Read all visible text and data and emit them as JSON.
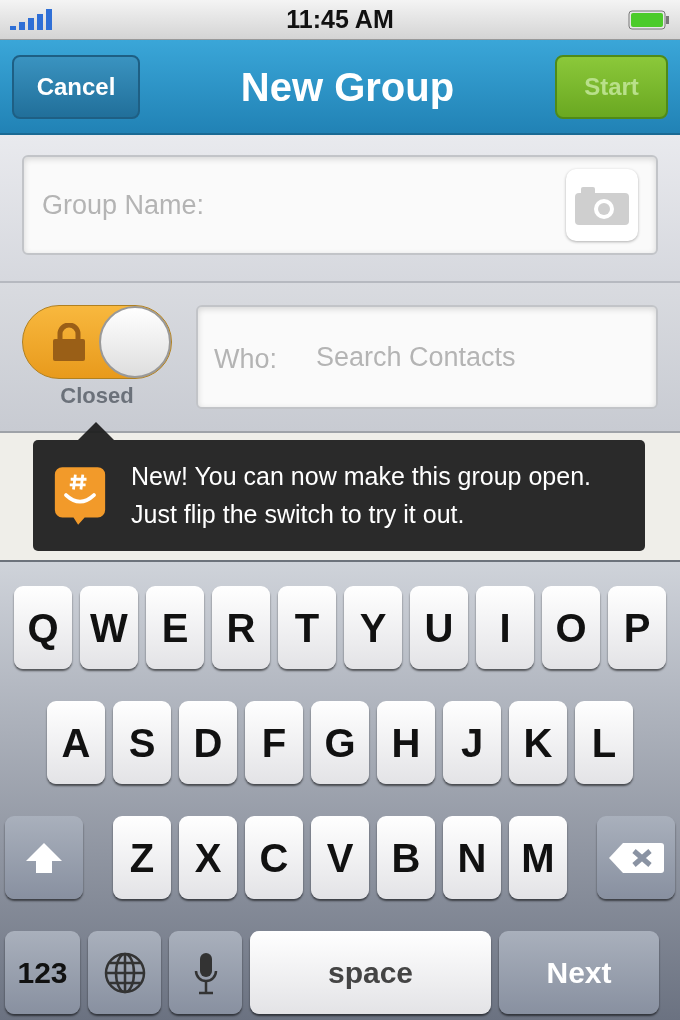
{
  "status_bar": {
    "time": "11:45 AM"
  },
  "nav": {
    "cancel": "Cancel",
    "title": "New Group",
    "start": {
      "label": "Start",
      "disabled": true
    }
  },
  "group_name": {
    "placeholder": "Group Name:"
  },
  "privacy_switch": {
    "open": false,
    "label": "Closed"
  },
  "who": {
    "label": "Who:",
    "placeholder": "Search Contacts"
  },
  "tooltip": {
    "text": "New! You can now make this group open. Just flip the switch to try it out."
  },
  "keyboard": {
    "rows": [
      {
        "keys": [
          {
            "kind": "letter",
            "label": "Q"
          },
          {
            "kind": "letter",
            "label": "W"
          },
          {
            "kind": "letter",
            "label": "E"
          },
          {
            "kind": "letter",
            "label": "R"
          },
          {
            "kind": "letter",
            "label": "T"
          },
          {
            "kind": "letter",
            "label": "Y"
          },
          {
            "kind": "letter",
            "label": "U"
          },
          {
            "kind": "letter",
            "label": "I"
          },
          {
            "kind": "letter",
            "label": "O"
          },
          {
            "kind": "letter",
            "label": "P"
          }
        ]
      },
      {
        "keys": [
          {
            "kind": "letter",
            "label": "A"
          },
          {
            "kind": "letter",
            "label": "S"
          },
          {
            "kind": "letter",
            "label": "D"
          },
          {
            "kind": "letter",
            "label": "F"
          },
          {
            "kind": "letter",
            "label": "G"
          },
          {
            "kind": "letter",
            "label": "H"
          },
          {
            "kind": "letter",
            "label": "J"
          },
          {
            "kind": "letter",
            "label": "K"
          },
          {
            "kind": "letter",
            "label": "L"
          }
        ]
      },
      {
        "keys": [
          {
            "kind": "shift"
          },
          {
            "kind": "letter",
            "label": "Z"
          },
          {
            "kind": "letter",
            "label": "X"
          },
          {
            "kind": "letter",
            "label": "C"
          },
          {
            "kind": "letter",
            "label": "V"
          },
          {
            "kind": "letter",
            "label": "B"
          },
          {
            "kind": "letter",
            "label": "N"
          },
          {
            "kind": "letter",
            "label": "M"
          },
          {
            "kind": "backspace"
          }
        ]
      },
      {
        "keys": [
          {
            "kind": "numbers",
            "label": "123"
          },
          {
            "kind": "globe"
          },
          {
            "kind": "mic"
          },
          {
            "kind": "space",
            "label": "space"
          },
          {
            "kind": "next",
            "label": "Next"
          }
        ]
      }
    ]
  }
}
